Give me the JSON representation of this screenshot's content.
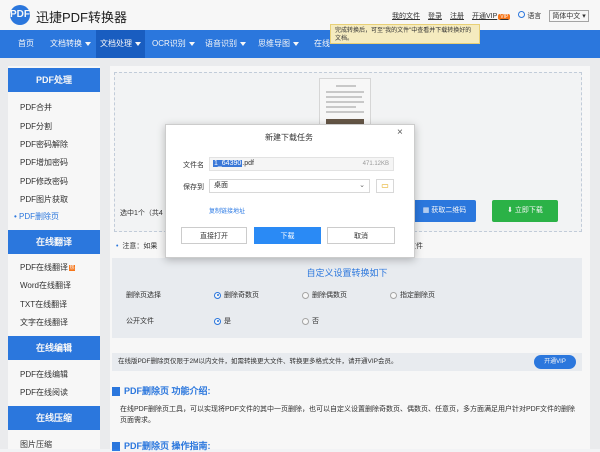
{
  "header": {
    "logo_text": "PDF",
    "brand": "迅捷PDF转换器",
    "links": [
      "我的文件",
      "登录",
      "注册",
      "开通VIP"
    ],
    "vip_badge": "VIP",
    "language_label": "语言",
    "language_value": "简体中文"
  },
  "tooltip": "完成转换后，可至\"我的文件\"中查看并下载转换好的文档。",
  "nav": [
    {
      "label": "首页",
      "caret": false,
      "active": false
    },
    {
      "label": "文档转换",
      "caret": true,
      "active": false
    },
    {
      "label": "文档处理",
      "caret": true,
      "active": true
    },
    {
      "label": "OCR识别",
      "caret": true,
      "active": false
    },
    {
      "label": "语音识别",
      "caret": true,
      "active": false
    },
    {
      "label": "思维导图",
      "caret": true,
      "active": false
    },
    {
      "label": "在线",
      "caret": false,
      "active": false
    }
  ],
  "sidebar": {
    "sections": [
      {
        "title": "PDF处理",
        "items": [
          "PDF合并",
          "PDF分割",
          "PDF密码解除",
          "PDF增加密码",
          "PDF修改密码",
          "PDF图片获取",
          "PDF删除页"
        ]
      },
      {
        "title": "在线翻译",
        "items": [
          "PDF在线翻译",
          "Word在线翻译",
          "TXT在线翻译",
          "文字在线翻译"
        ]
      },
      {
        "title": "在线编辑",
        "items": [
          "PDF在线编辑",
          "PDF在线阅读"
        ]
      },
      {
        "title": "在线压缩",
        "items": [
          "图片压缩"
        ]
      }
    ],
    "active_item": "PDF删除页",
    "hot_item": "PDF在线翻译"
  },
  "upload": {
    "selected_info": "选中1个（共4",
    "qr_button": "获取二维码",
    "download_button": "立即下载"
  },
  "note": {
    "prefix": "注意：如果",
    "tail": "文件"
  },
  "settings": {
    "title": "自定义设置转换如下",
    "rows": [
      {
        "label": "删除页选择",
        "options": [
          "删除奇数页",
          "删除偶数页",
          "指定删除页"
        ],
        "selected": 0
      },
      {
        "label": "公开文件",
        "options": [
          "是",
          "否"
        ],
        "selected": 0
      }
    ]
  },
  "limits": {
    "text": "在线版PDF删除页仅限于2M以内文件，如需转换更大文件、转换更多格式文件，请开通VIP会员。",
    "vip_button": "开通VIP"
  },
  "intro": {
    "title": "PDF删除页 功能介绍:",
    "body": "在线PDF删除页工具，可以实现将PDF文件的其中一页删除，也可以自定义设置删除奇数页、偶数页、任意页，多方面满足用户针对PDF文件的删除页面需求。",
    "guide_title": "PDF删除页 操作指南:"
  },
  "dialog": {
    "title": "新建下载任务",
    "close": "×",
    "filename_label": "文件名",
    "filename_selected": "1_64390",
    "filename_ext": ".pdf",
    "filesize": "471.12KB",
    "saveto_label": "保存到",
    "saveto_value": "桌面",
    "copy_link": "复制链接地址",
    "open_button": "直接打开",
    "download_button": "下载",
    "cancel_button": "取消"
  }
}
